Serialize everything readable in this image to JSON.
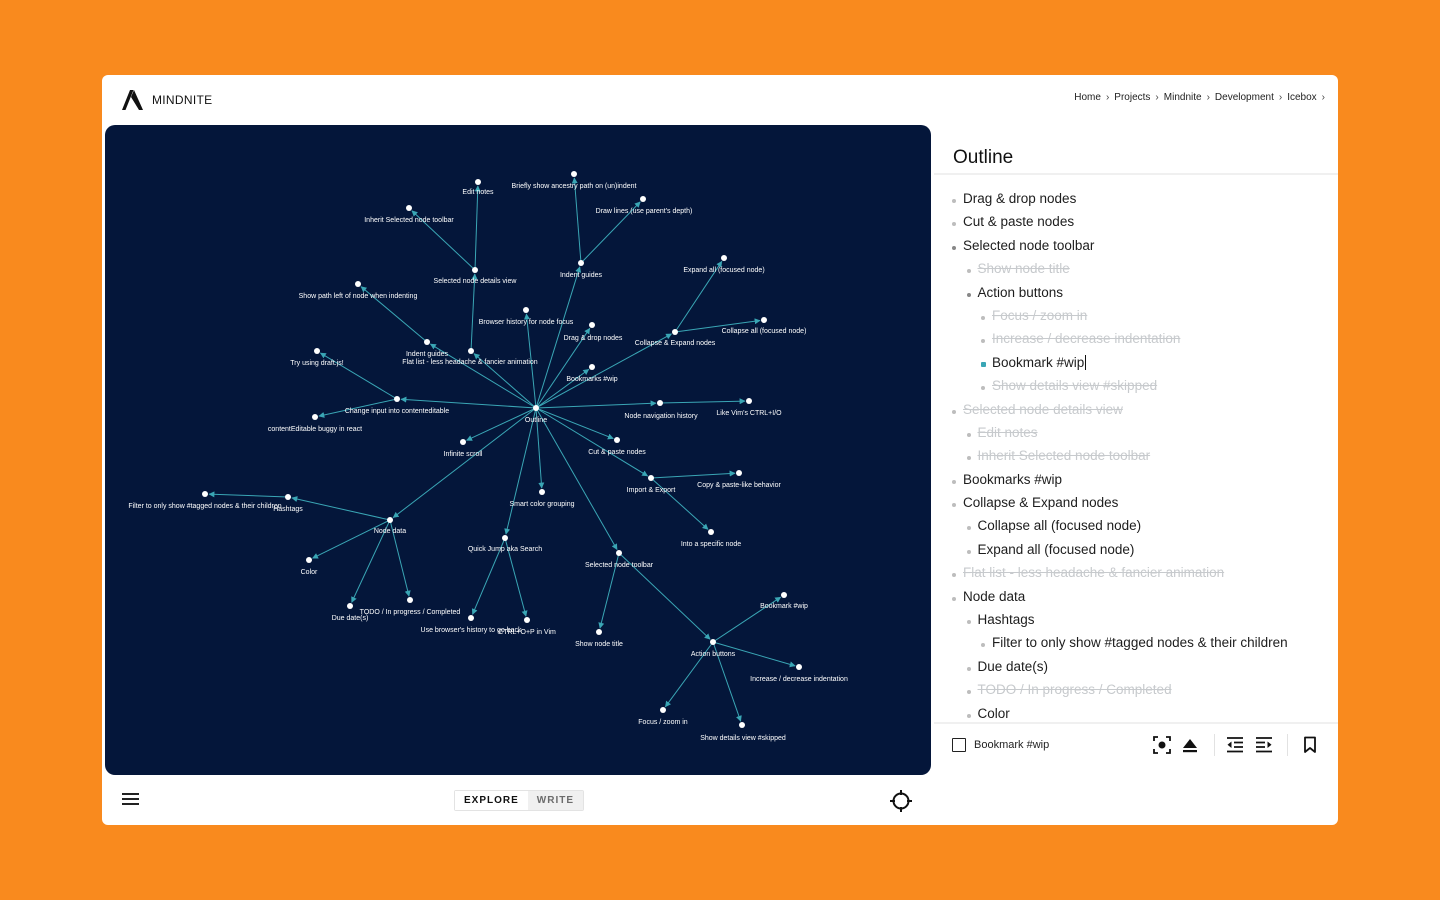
{
  "header": {
    "logo_text": "MINDNITE",
    "breadcrumb": [
      "Home",
      "Projects",
      "Mindnite",
      "Development",
      "Icebox"
    ],
    "breadcrumb_separator": "›"
  },
  "graph": {
    "background": "#04163a",
    "edge_color": "#3aa6b5",
    "node_color": "#ffffff",
    "labels": [
      "Edit notes",
      "Briefly show ancestry path on (un)indent",
      "Inherit Selected node toolbar",
      "Draw lines (use parent's depth)",
      "Selected node details view",
      "Indent guides",
      "Expand all (focused node)",
      "Show path left of node when indenting",
      "Browser history for node focus",
      "Collapse all (focused node)",
      "Drag & drop nodes",
      "Collapse & Expand nodes",
      "Indent guides",
      "Flat list - less headache & fancier animation",
      "Try using draft.js!",
      "Bookmarks #wip",
      "Change input into contenteditable",
      "Node navigation history",
      "Like Vim's CTRL+I/O",
      "contentEditable buggy in react",
      "Outline",
      "Infinite scroll",
      "Cut & paste nodes",
      "Copy & paste-like behavior",
      "Import & Export",
      "Filter to only show #tagged nodes & their children",
      "Hashtags",
      "Smart color grouping",
      "Node data",
      "Into a specific node",
      "Quick Jump aka Search",
      "Selected node toolbar",
      "Color",
      "Bookmark #wip",
      "TODO / In progress / Completed",
      "Due date(s)",
      "Use browser's history to go back",
      "CTRL+O+P in Vim",
      "Show node title",
      "Action buttons",
      "Increase / decrease indentation",
      "Focus / zoom in",
      "Show details view #skipped"
    ]
  },
  "bottom": {
    "menu_icon": "hamburger-icon",
    "modes": [
      "EXPLORE",
      "WRITE"
    ],
    "active_mode": "EXPLORE",
    "recenter_icon": "crosshair-icon"
  },
  "outline": {
    "title": "Outline",
    "active_color": "#3aa6b5",
    "items": [
      {
        "label": "Drag & drop nodes",
        "level": 0,
        "struck": false
      },
      {
        "label": "Cut & paste nodes",
        "level": 0,
        "struck": false
      },
      {
        "label": "Selected node toolbar",
        "level": 0,
        "struck": false,
        "parent": true
      },
      {
        "label": "Show node title",
        "level": 1,
        "struck": true
      },
      {
        "label": "Action buttons",
        "level": 1,
        "struck": false,
        "parent": true
      },
      {
        "label": "Focus / zoom in",
        "level": 2,
        "struck": true
      },
      {
        "label": "Increase / decrease indentation",
        "level": 2,
        "struck": true
      },
      {
        "label": "Bookmark #wip",
        "level": 2,
        "struck": false,
        "active": true
      },
      {
        "label": "Show details view #skipped",
        "level": 2,
        "struck": true
      },
      {
        "label": "Selected node details view",
        "level": 0,
        "struck": true
      },
      {
        "label": "Edit notes",
        "level": 1,
        "struck": true
      },
      {
        "label": "Inherit Selected node toolbar",
        "level": 1,
        "struck": true
      },
      {
        "label": "Bookmarks #wip",
        "level": 0,
        "struck": false
      },
      {
        "label": "Collapse & Expand nodes",
        "level": 0,
        "struck": false
      },
      {
        "label": "Collapse all (focused node)",
        "level": 1,
        "struck": false
      },
      {
        "label": "Expand all (focused node)",
        "level": 1,
        "struck": false
      },
      {
        "label": "Flat list - less headache & fancier animation",
        "level": 0,
        "struck": true
      },
      {
        "label": "Node data",
        "level": 0,
        "struck": false
      },
      {
        "label": "Hashtags",
        "level": 1,
        "struck": false
      },
      {
        "label": "Filter to only show #tagged nodes & their children",
        "level": 2,
        "struck": false
      },
      {
        "label": "Due date(s)",
        "level": 1,
        "struck": false
      },
      {
        "label": "TODO / In progress / Completed",
        "level": 1,
        "struck": true
      },
      {
        "label": "Color",
        "level": 1,
        "struck": false
      }
    ]
  },
  "toolbar": {
    "selected_label": "Bookmark #wip",
    "checked": false,
    "icons": [
      "focus-icon",
      "eject-icon",
      "outdent-icon",
      "indent-icon",
      "bookmark-icon"
    ]
  }
}
